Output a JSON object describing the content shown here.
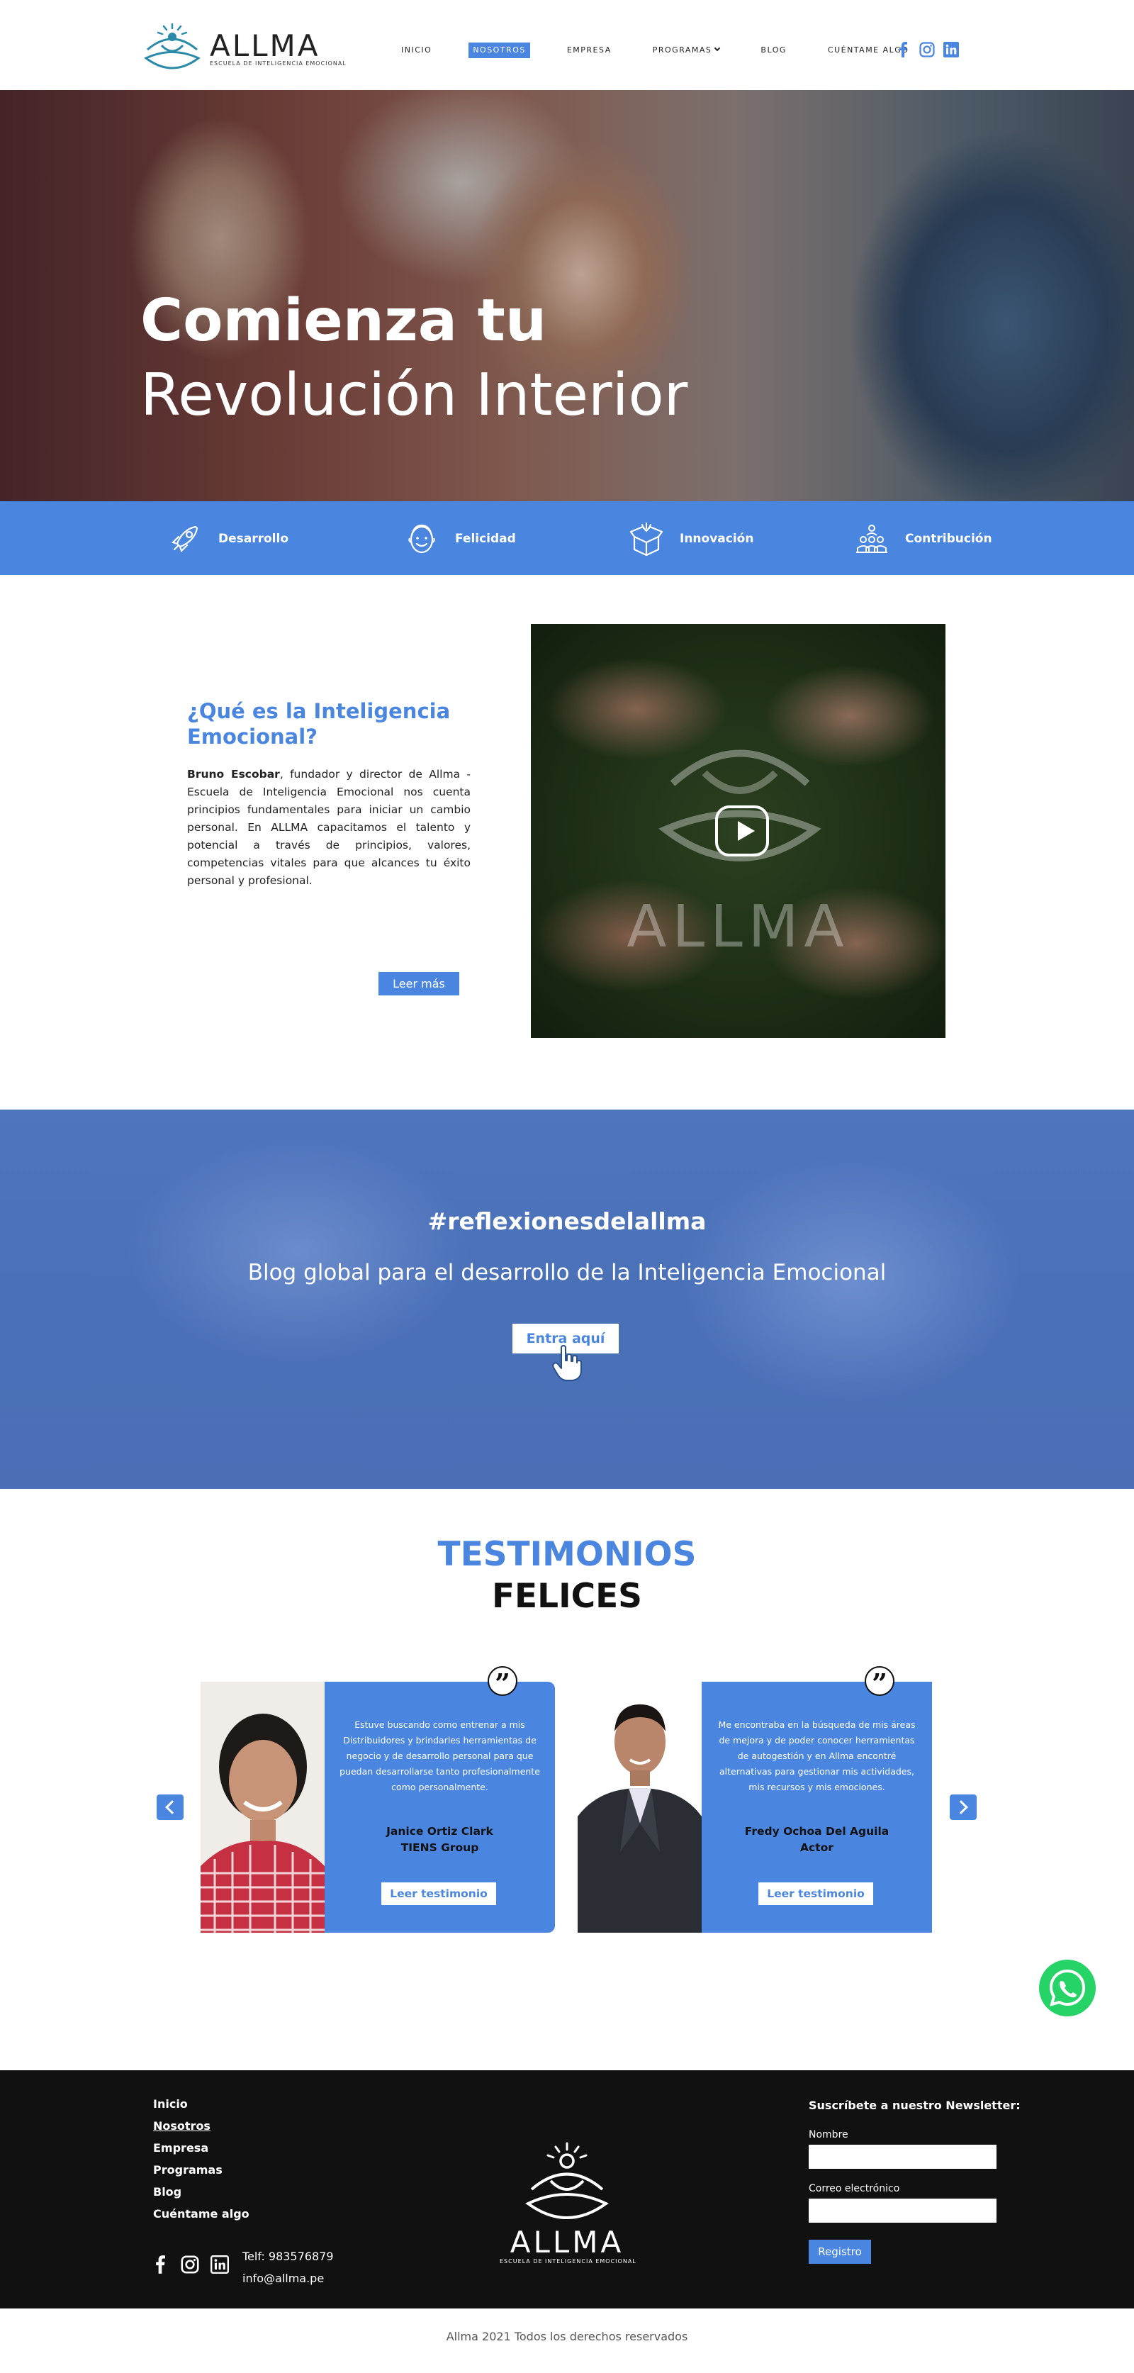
{
  "brand": {
    "name": "ALLMA",
    "tagline": "ESCUELA DE INTELIGENCIA EMOCIONAL",
    "accent_color": "#4a86df"
  },
  "nav": {
    "items": [
      {
        "label": "INICIO"
      },
      {
        "label": "NOSOTROS",
        "active": true
      },
      {
        "label": "EMPRESA"
      },
      {
        "label": "PROGRAMAS"
      },
      {
        "label": "BLOG"
      },
      {
        "label": "CUÉNTAME ALGO"
      }
    ],
    "social_icons": [
      "facebook-icon",
      "instagram-icon",
      "linkedin-icon"
    ]
  },
  "hero": {
    "title_line1": "Comienza tu",
    "title_line2": "Revolución Interior"
  },
  "pillars": [
    {
      "label": "Desarrollo",
      "icon": "rocket-icon"
    },
    {
      "label": "Felicidad",
      "icon": "smiling-face-icon"
    },
    {
      "label": "Innovación",
      "icon": "open-box-icon"
    },
    {
      "label": "Contribución",
      "icon": "group-icon"
    }
  ],
  "about": {
    "title": "¿Qué es la Inteligencia Emocional?",
    "text_bold": "Bruno Escobar",
    "text": ", fundador y director de Allma - Escuela de Inteligencia Emocional nos cuenta principios fundamentales para iniciar un cambio personal. En ALLMA capacitamos el talento y potencial a través de principios, valores, competencias vitales para que alcances tu éxito personal y profesional.",
    "button": "Leer más",
    "video_brand": "ALLMA"
  },
  "blog": {
    "hashtag": "#reflexionesdelallma",
    "subtitle": "Blog global para el desarrollo de la Inteligencia Emocional",
    "button": "Entra aquí"
  },
  "testimonials": {
    "title": "TESTIMONIOS",
    "title2": "FELICES",
    "items": [
      {
        "quote": "Estuve buscando como entrenar a mis Distribuidores y brindarles herramientas de negocio y de desarrollo personal para que puedan desarrollarse tanto profesionalmente como personalmente.",
        "name": "Janice Ortiz Clark",
        "company": "TIENS Group",
        "button": "Leer testimonio"
      },
      {
        "quote": "Me encontraba en la búsqueda de mis áreas de mejora y de poder conocer herramientas de autogestión y en Allma encontré alternativas para gestionar mis actividades, mis recursos y mis emociones.",
        "name": "Fredy Ochoa Del Aguila",
        "company": "Actor",
        "button": "Leer testimonio"
      }
    ]
  },
  "footer": {
    "nav": [
      {
        "label": "Inicio"
      },
      {
        "label": "Nosotros",
        "active": true
      },
      {
        "label": "Empresa"
      },
      {
        "label": "Programas"
      },
      {
        "label": "Blog"
      },
      {
        "label": "Cuéntame algo"
      }
    ],
    "phone": "Telf: 983576879",
    "email": "info@allma.pe",
    "newsletter": {
      "title": "Suscríbete a nuestro Newsletter:",
      "name_label": "Nombre",
      "email_label": "Correo electrónico",
      "button": "Registro"
    }
  },
  "copyright": "Allma 2021 Todos los derechos reservados"
}
